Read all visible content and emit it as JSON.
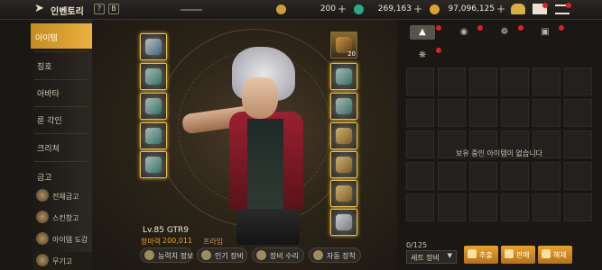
{
  "topbar": {
    "title": "인벤토리",
    "help_label": "?",
    "b_label": "B",
    "currencies": [
      {
        "icon": "gold-coin-icon",
        "value": "200",
        "color": "#c8a030"
      },
      {
        "icon": "green-gem-icon",
        "value": "269,163",
        "color": "#2aa888"
      },
      {
        "icon": "gold-bag-icon",
        "value": "97,096,125",
        "color": "#e0a030"
      }
    ]
  },
  "leftmenu": {
    "items": [
      {
        "label": "아이템",
        "active": true
      },
      {
        "label": "칭호"
      },
      {
        "label": "아바타"
      },
      {
        "label": "룬 각인"
      },
      {
        "label": "크리쳐"
      }
    ],
    "section_label": "금고",
    "sub_items": [
      {
        "label": "전체금고"
      },
      {
        "label": "스킨창고"
      },
      {
        "label": "아이템 도감"
      },
      {
        "label": "무기고",
        "active": true
      }
    ]
  },
  "character": {
    "level": "Lv.85 GTR9",
    "power_label": "항마력",
    "power_value": "200,011",
    "prime_label": "프라임",
    "special_slot_badge": "20"
  },
  "bottom_buttons": [
    {
      "label": "능력치 정보"
    },
    {
      "label": "인기 장비"
    },
    {
      "label": "장비 수리"
    },
    {
      "label": "자동 장착"
    }
  ],
  "rightpanel": {
    "empty_message": "보유 중인 아이템이 없습니다",
    "count": "0/125",
    "set_select": "세트 장비",
    "actions": [
      {
        "label": "추출"
      },
      {
        "label": "판매"
      },
      {
        "label": "해체"
      }
    ]
  },
  "colors": {
    "accent": "#e0a428",
    "slot_glow": "#e8c04a",
    "notify": "#e02020"
  }
}
